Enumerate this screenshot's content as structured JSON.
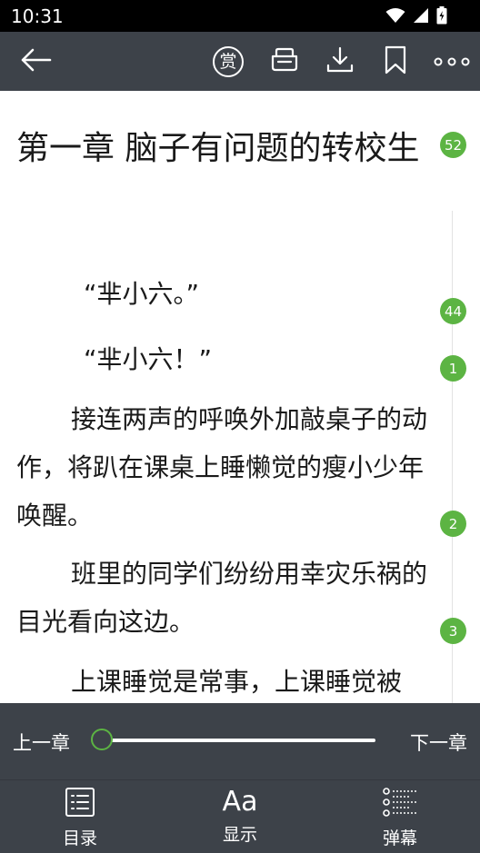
{
  "status": {
    "time": "10:31"
  },
  "icons": {
    "back": "arrow-left-icon",
    "reward": "reward-icon",
    "share": "share-icon",
    "download": "download-icon",
    "bookmark": "bookmark-icon",
    "more": "more-icon",
    "wifi": "wifi-icon",
    "signal": "signal-icon",
    "battery": "battery-icon"
  },
  "header": {
    "reward_label": "赏"
  },
  "chapter": {
    "title": "第一章 脑子有问题的转校生",
    "paragraphs": [
      "“芈小六。”",
      "“芈小六！”",
      "接连两声的呼唤外加敲桌子的动作，将趴在课桌上睡懒觉的瘦小少年唤醒。",
      "班里的同学们纷纷用幸灾乐祸的目光看向这边。",
      "上课睡觉是常事，上课睡觉被"
    ],
    "comment_counts": [
      "52",
      "44",
      "1",
      "2",
      "3"
    ]
  },
  "reader_nav": {
    "prev_label": "上一章",
    "next_label": "下一章",
    "progress_fraction": 0.0
  },
  "toolbar": {
    "items": [
      {
        "label": "目录",
        "icon": "toc-icon"
      },
      {
        "label": "显示",
        "icon": "font-display-icon",
        "glyph": "Aa"
      },
      {
        "label": "弹幕",
        "icon": "danmaku-icon"
      }
    ]
  },
  "colors": {
    "accent": "#5cb443",
    "toolbar_bg": "#3d4249",
    "status_bg": "#000000",
    "text": "#1a1a1a"
  }
}
